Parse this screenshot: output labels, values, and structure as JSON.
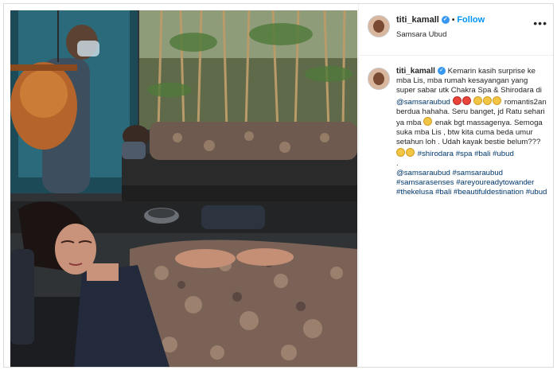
{
  "post": {
    "username": "titi_kamall",
    "follow_label": "Follow",
    "location": "Samsara Ubud",
    "more_label": "•••"
  },
  "caption": {
    "username": "titi_kamall",
    "line1": "Kemarin kasih surprise ke mba Lis, mba rumah kesayangan yang super sabar utk Chakra Spa & Shirodara di",
    "mention1": "@samsaraubud",
    "line2": "romantis2an berdua hahaha. Seru banget, jd Ratu sehari ya mba",
    "line3": "enak bgt massagenya. Semoga suka mba Lis , btw kita cuma beda umur setahun loh . Udah kayak bestie belum???",
    "tags1": [
      "#shirodara",
      "#spa",
      "#bali",
      "#ubud"
    ],
    "separator": ".",
    "tags2": [
      "@samsaraubud",
      "#samsaraubud",
      "#samsarasenses",
      "#areyoureadytowander",
      "#thekelusa",
      "#bali",
      "#beautifuldestination",
      "#ubud"
    ]
  },
  "icons": {
    "verified": "verified-badge-icon",
    "emoji_heart_eyes": "heart-eyes-emoji-icon",
    "emoji_grin": "grinning-emoji-icon"
  },
  "colors": {
    "link": "#00376b",
    "follow": "#0095f6",
    "verified": "#3897f0"
  }
}
